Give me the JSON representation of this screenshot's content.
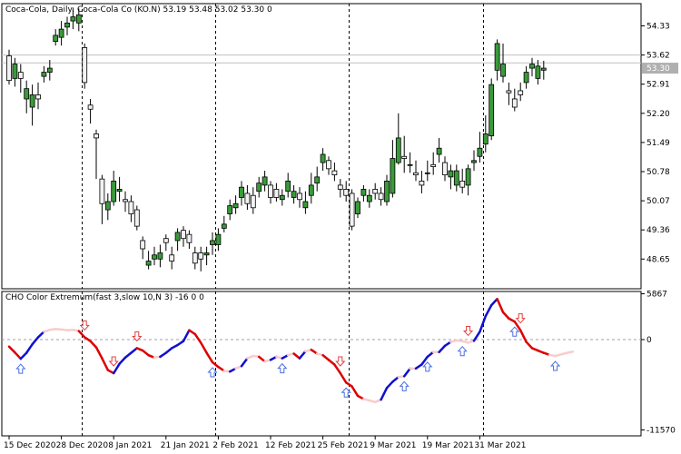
{
  "window": {
    "symbol": "Coca-Cola",
    "timeframe": "Daily",
    "description": "Coca-Cola Co (KO.N)",
    "ohlc": "53.19 53.48 53.02 53.30",
    "volume": "0"
  },
  "indicator": {
    "title": "CHO Color Extremum(fast 3,slow 10,N 3) -16 0 0"
  },
  "colors": {
    "bull": "#3a9a3a",
    "bear": "#f2f2f2",
    "line_up": "#1010d0",
    "line_down": "#dd0000",
    "line_light": "#f8cccc",
    "arrow_up": "#4a6ee0",
    "arrow_down": "#e04040",
    "grid": "#000000",
    "price_bg": "#b0b0b0"
  },
  "chart_data": [
    {
      "type": "candlestick",
      "title": "Coca-Cola, Daily:  Coca-Cola Co (KO.N)  53.19 53.48 53.02 53.30  0",
      "ylim": [
        48.2,
        54.75
      ],
      "y_ticks": [
        "54.33",
        "53.62",
        "52.91",
        "52.20",
        "51.49",
        "50.78",
        "50.07",
        "49.36",
        "48.65"
      ],
      "current_price": "53.30",
      "current_price_value": 53.3,
      "reference_lines": [
        53.62,
        53.43
      ],
      "x_ticks": [
        "15 Dec 2020",
        "28 Dec 2020",
        "8 Jan 2021",
        "21 Jan 2021",
        "2 Feb 2021",
        "12 Feb 2021",
        "25 Feb 2021",
        "9 Mar 2021",
        "19 Mar 2021",
        "31 Mar 2021"
      ],
      "period_separators_after_index": [
        12,
        35,
        58,
        81
      ],
      "candles": [
        [
          53.6,
          53.0,
          53.75,
          52.9
        ],
        [
          53.05,
          53.4,
          53.55,
          52.85
        ],
        [
          53.2,
          53.05,
          53.4,
          52.7
        ],
        [
          52.55,
          52.8,
          53.0,
          52.2
        ],
        [
          52.35,
          52.65,
          52.9,
          51.9
        ],
        [
          52.65,
          52.55,
          52.95,
          52.3
        ],
        [
          53.1,
          53.2,
          53.35,
          52.95
        ],
        [
          53.2,
          53.3,
          53.5,
          53.0
        ],
        [
          53.95,
          54.1,
          54.25,
          53.85
        ],
        [
          54.05,
          54.25,
          54.45,
          53.85
        ],
        [
          54.3,
          54.4,
          54.55,
          54.1
        ],
        [
          54.45,
          54.55,
          54.75,
          54.25
        ],
        [
          54.4,
          54.6,
          54.75,
          54.2
        ],
        [
          53.8,
          52.95,
          53.9,
          52.8
        ],
        [
          52.4,
          52.3,
          52.55,
          51.95
        ],
        [
          51.7,
          51.6,
          51.8,
          50.6
        ],
        [
          50.6,
          50.0,
          50.7,
          49.5
        ],
        [
          49.85,
          50.05,
          50.25,
          49.6
        ],
        [
          50.05,
          50.55,
          50.8,
          49.95
        ],
        [
          50.3,
          50.35,
          50.65,
          50.05
        ],
        [
          50.1,
          50.05,
          50.3,
          49.8
        ],
        [
          50.05,
          49.75,
          50.2,
          49.55
        ],
        [
          49.85,
          49.45,
          49.95,
          49.35
        ],
        [
          49.1,
          48.9,
          49.2,
          48.65
        ],
        [
          48.5,
          48.6,
          48.85,
          48.4
        ],
        [
          48.65,
          48.75,
          48.95,
          48.5
        ],
        [
          48.65,
          48.8,
          49.0,
          48.45
        ],
        [
          49.15,
          49.05,
          49.25,
          48.85
        ],
        [
          48.75,
          48.6,
          48.95,
          48.4
        ],
        [
          49.1,
          49.3,
          49.4,
          48.85
        ],
        [
          49.35,
          49.15,
          49.45,
          48.95
        ],
        [
          49.25,
          49.05,
          49.35,
          48.9
        ],
        [
          48.8,
          48.55,
          48.95,
          48.4
        ],
        [
          48.8,
          48.65,
          48.95,
          48.35
        ],
        [
          48.75,
          48.8,
          48.95,
          48.5
        ],
        [
          49.0,
          49.1,
          49.3,
          48.75
        ],
        [
          49.0,
          49.25,
          49.4,
          48.85
        ],
        [
          49.4,
          49.5,
          49.7,
          49.3
        ],
        [
          49.75,
          49.95,
          50.1,
          49.6
        ],
        [
          49.9,
          50.0,
          50.2,
          49.75
        ],
        [
          50.15,
          50.4,
          50.55,
          49.95
        ],
        [
          50.25,
          50.0,
          50.45,
          49.85
        ],
        [
          50.2,
          49.9,
          50.4,
          49.75
        ],
        [
          50.3,
          50.5,
          50.65,
          50.15
        ],
        [
          50.45,
          50.65,
          50.8,
          50.3
        ],
        [
          50.45,
          50.15,
          50.55,
          50.0
        ],
        [
          50.35,
          50.15,
          50.5,
          50.05
        ],
        [
          50.1,
          50.2,
          50.35,
          49.95
        ],
        [
          50.3,
          50.55,
          50.75,
          50.15
        ],
        [
          50.15,
          50.3,
          50.45,
          50.0
        ],
        [
          50.25,
          50.1,
          50.4,
          49.9
        ],
        [
          49.9,
          50.05,
          50.3,
          49.75
        ],
        [
          50.2,
          50.45,
          50.75,
          50.0
        ],
        [
          50.5,
          50.65,
          50.9,
          50.3
        ],
        [
          51.0,
          51.2,
          51.35,
          50.8
        ],
        [
          51.05,
          50.85,
          51.15,
          50.7
        ],
        [
          50.8,
          50.7,
          51.0,
          50.55
        ],
        [
          50.45,
          50.35,
          50.6,
          50.15
        ],
        [
          50.35,
          50.2,
          50.55,
          50.05
        ],
        [
          50.25,
          49.45,
          50.35,
          49.35
        ],
        [
          49.75,
          50.05,
          50.15,
          49.65
        ],
        [
          50.2,
          50.35,
          50.45,
          50.05
        ],
        [
          50.05,
          50.2,
          50.35,
          49.9
        ],
        [
          50.35,
          50.25,
          50.5,
          50.1
        ],
        [
          50.25,
          50.1,
          50.4,
          49.95
        ],
        [
          50.05,
          50.55,
          50.7,
          49.95
        ],
        [
          50.25,
          51.1,
          51.55,
          50.15
        ],
        [
          51.0,
          51.6,
          52.2,
          50.95
        ],
        [
          51.15,
          51.1,
          51.65,
          50.75
        ],
        [
          50.95,
          50.95,
          51.25,
          50.75
        ],
        [
          50.75,
          50.7,
          51.05,
          50.55
        ],
        [
          50.55,
          50.45,
          50.8,
          50.25
        ],
        [
          50.75,
          50.75,
          51.05,
          50.55
        ],
        [
          50.95,
          50.9,
          51.25,
          50.7
        ],
        [
          51.2,
          51.35,
          51.6,
          51.0
        ],
        [
          51.0,
          50.7,
          51.15,
          50.55
        ],
        [
          50.65,
          50.8,
          50.95,
          50.35
        ],
        [
          50.45,
          50.8,
          50.95,
          50.3
        ],
        [
          50.55,
          50.4,
          50.85,
          50.25
        ],
        [
          50.45,
          50.85,
          50.95,
          50.2
        ],
        [
          51.0,
          51.05,
          51.3,
          50.8
        ],
        [
          51.15,
          51.35,
          51.75,
          51.0
        ],
        [
          51.45,
          51.7,
          52.15,
          51.25
        ],
        [
          51.65,
          52.9,
          53.05,
          51.55
        ],
        [
          53.25,
          53.9,
          54.0,
          53.0
        ],
        [
          53.1,
          53.4,
          53.9,
          52.95
        ],
        [
          52.75,
          52.7,
          52.95,
          52.4
        ],
        [
          52.55,
          52.35,
          52.8,
          52.25
        ],
        [
          52.75,
          52.65,
          52.95,
          52.5
        ],
        [
          52.95,
          53.2,
          53.35,
          52.8
        ],
        [
          53.3,
          53.4,
          53.55,
          53.1
        ],
        [
          53.05,
          53.35,
          53.5,
          52.9
        ],
        [
          53.25,
          53.3,
          53.48,
          53.02
        ]
      ]
    },
    {
      "type": "line",
      "title": "CHO Color Extremum(fast 3,slow 10,N 3) -16 0 0",
      "ylim": [
        -11570,
        5867
      ],
      "y_ticks": [
        "5867",
        "0",
        "-11570"
      ],
      "zero_line": 0,
      "series": [
        {
          "values": [
            -900,
            -1650,
            -2450,
            -1700,
            -600,
            300,
            1000,
            1250,
            1350,
            1300,
            1200,
            1250,
            1100,
            300,
            -200,
            -1000,
            -2400,
            -3900,
            -4300,
            -3100,
            -2300,
            -1700,
            -1100,
            -1400,
            -2000,
            -2300,
            -2200,
            -1700,
            -1100,
            -700,
            -200,
            1200,
            700,
            -400,
            -1700,
            -2900,
            -3500,
            -4000,
            -4100,
            -3700,
            -3400,
            -2400,
            -2100,
            -2200,
            -2800,
            -2600,
            -2200,
            -2400,
            -2000,
            -1800,
            -2400,
            -1500,
            -1300,
            -1800,
            -2000,
            -2600,
            -3200,
            -4300,
            -5500,
            -6000,
            -7200,
            -7600,
            -7800,
            -8000,
            -7700,
            -6200,
            -5400,
            -4800,
            -4700,
            -3700,
            -3700,
            -3200,
            -2200,
            -1600,
            -1600,
            -800,
            -300,
            -100,
            -200,
            -400,
            -150,
            1000,
            3000,
            4400,
            5200,
            3500,
            2700,
            2300,
            1200,
            -300,
            -1100,
            -1400,
            -1700,
            -1950,
            -2100,
            -1900,
            -1700,
            -1550
          ]
        }
      ],
      "up_arrows_at_index": [
        2,
        35,
        47,
        58,
        68,
        72,
        78,
        87,
        94
      ],
      "down_arrows_at_index": [
        13,
        18,
        22,
        57,
        79,
        88
      ]
    }
  ]
}
